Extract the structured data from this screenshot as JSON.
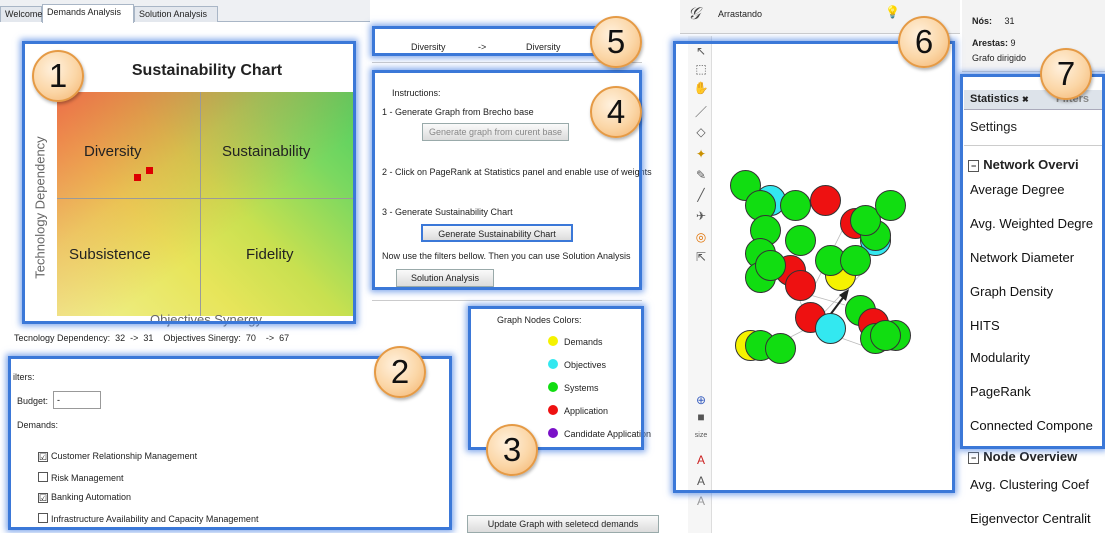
{
  "tabs": [
    "Welcome",
    "Demands Analysis",
    "Solution Analysis"
  ],
  "callouts": [
    "1",
    "2",
    "3",
    "4",
    "5",
    "6",
    "7"
  ],
  "chart": {
    "title": "Sustainability Chart",
    "quadrants": [
      "Diversity",
      "Sustainability",
      "Subsistence",
      "Fidelity"
    ],
    "xlabel": "Objectives Synergy",
    "ylabel": "Technology Dependency",
    "readout": "Tecnology Dependency:  32  ->  31    Objectives Sinergy:  70    ->  67"
  },
  "chart_data": {
    "type": "scatter",
    "title": "Sustainability Chart",
    "xlabel": "Objectives Synergy",
    "ylabel": "Technology Dependency",
    "points": [
      {
        "x": 0.27,
        "y": 0.62
      },
      {
        "x": 0.31,
        "y": 0.65
      }
    ]
  },
  "transition": {
    "from": "Diversity",
    "arrow": "->",
    "to": "Diversity"
  },
  "instructions": {
    "header": "Instructions:",
    "step1": "1 - Generate Graph from Brecho base",
    "btn1": "Generate graph from curent base",
    "step2": "2 - Click on PageRank at Statistics panel and enable use of weights",
    "step3": "3 - Generate Sustainability Chart",
    "btn3": "Generate Sustainability Chart",
    "note": "Now use the filters bellow. Then you can use Solution Analysis",
    "btn4": "Solution Analysis"
  },
  "filters": {
    "title": "ilters:",
    "budget_label": "Budget:",
    "budget_value": "-",
    "demands_label": "Demands:",
    "items": [
      {
        "label": "Customer Relationship Management",
        "checked": "☑"
      },
      {
        "label": "Risk Management",
        "checked": ""
      },
      {
        "label": "Banking Automation",
        "checked": "☑"
      },
      {
        "label": "Infrastructure Availability and Capacity Management",
        "checked": ""
      }
    ],
    "update_button": "Update Graph with seletecd demands"
  },
  "legend": {
    "title": "Graph Nodes Colors:",
    "items": [
      {
        "label": "Demands",
        "color": "#f5f200"
      },
      {
        "label": "Objectives",
        "color": "#33e8f0"
      },
      {
        "label": "Systems",
        "color": "#11dd11"
      },
      {
        "label": "Application",
        "color": "#ee1111"
      },
      {
        "label": "Candidate Application",
        "color": "#7a10c8"
      }
    ]
  },
  "graph": {
    "status": "Arrastando",
    "tool_size": "size",
    "nodes_label": "Nós:",
    "nodes_value": "31",
    "edges_label": "Arestas:",
    "edges_value": "9",
    "graph_type": "Grafo dirigido"
  },
  "stats": {
    "tab_statistics": "Statistics",
    "tab_filters": "Filters",
    "settings": "Settings",
    "network_overview": "Network Overvi",
    "items": [
      "Average Degree",
      "Avg. Weighted Degre",
      "Network Diameter",
      "Graph Density",
      "HITS",
      "Modularity",
      "PageRank",
      "Connected Compone"
    ],
    "node_overview": "Node Overview",
    "node_items": [
      "Avg. Clustering Coef",
      "Eigenvector Centralit"
    ]
  },
  "colors": {
    "accent": "#3b78d8",
    "callout": "#fbd6a6"
  }
}
